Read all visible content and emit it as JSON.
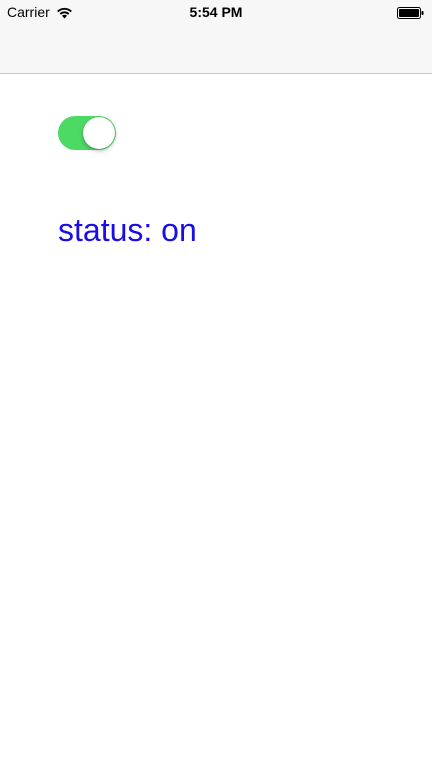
{
  "status_bar": {
    "carrier": "Carrier",
    "time": "5:54 PM",
    "wifi_icon": "wifi-icon",
    "battery_icon": "battery-icon"
  },
  "switch": {
    "state": "on",
    "on_color": "#4cd964"
  },
  "status_label": {
    "text": "status: on",
    "color": "#1a0de6"
  }
}
